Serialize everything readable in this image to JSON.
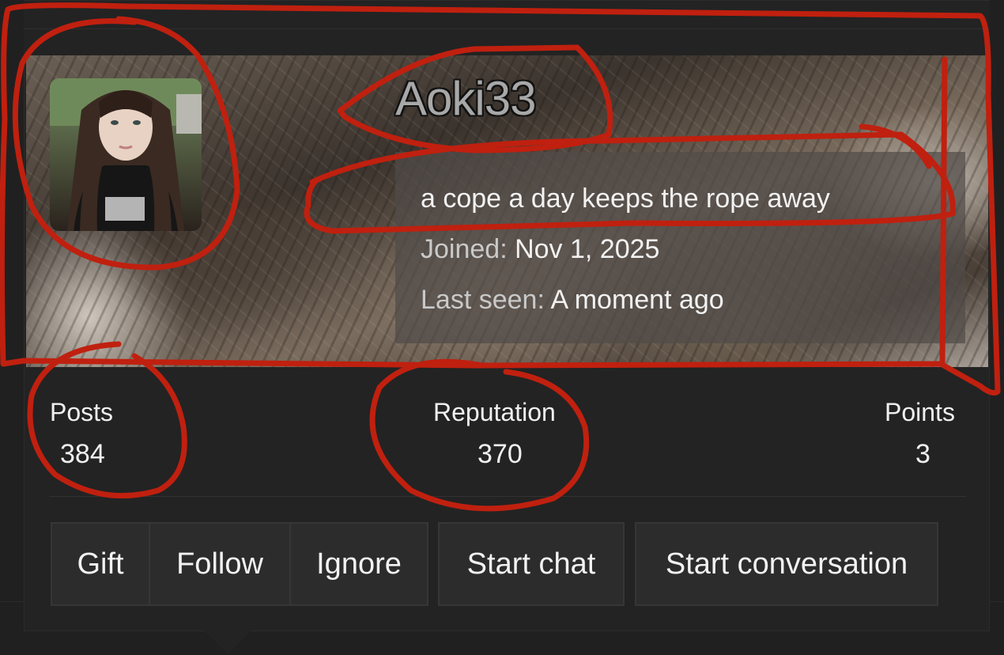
{
  "profile": {
    "username": "Aoki33",
    "status_message": "a cope a day keeps the rope away",
    "joined_label": "Joined:",
    "joined_value": "Nov 1, 2025",
    "last_seen_label": "Last seen:",
    "last_seen_value": "A moment ago"
  },
  "stats": {
    "posts_label": "Posts",
    "posts_value": "384",
    "reputation_label": "Reputation",
    "reputation_value": "370",
    "points_label": "Points",
    "points_value": "3"
  },
  "actions": {
    "gift": "Gift",
    "follow": "Follow",
    "ignore": "Ignore",
    "start_chat": "Start chat",
    "start_conversation": "Start conversation"
  },
  "annotation_color": "#c0200f"
}
